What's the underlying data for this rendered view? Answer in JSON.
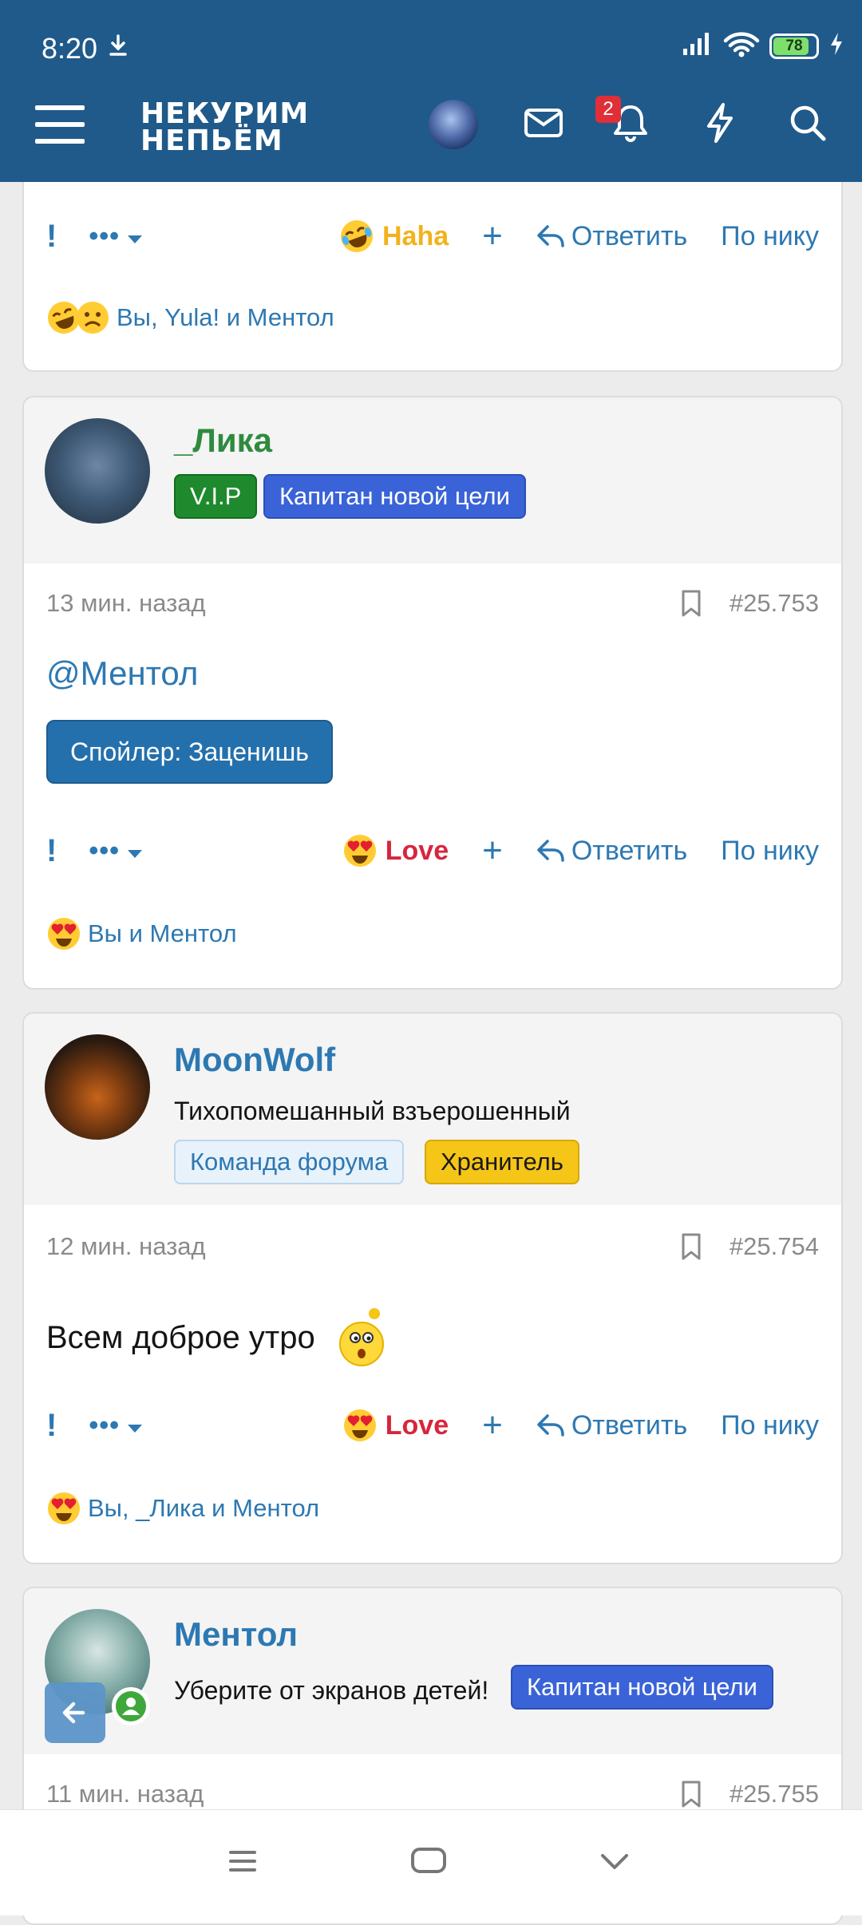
{
  "status": {
    "time": "8:20",
    "battery": "78"
  },
  "header": {
    "logo_line1": "НЕКУРИМ",
    "logo_line2": "НЕПЬЁМ",
    "notif_count": "2"
  },
  "posts": [
    {
      "actions": {
        "reaction": "Haha",
        "reply": "Ответить",
        "by_nick": "По нику"
      },
      "react_summary": "Вы, Yula! и Ментол"
    },
    {
      "user": {
        "name": "_Лика",
        "tags": [
          "V.I.P",
          "Капитан новой цели"
        ]
      },
      "time": "13 мин. назад",
      "number": "#25.753",
      "mention": "@Ментол",
      "spoiler": "Спойлер: Заценишь",
      "actions": {
        "reaction": "Love",
        "reply": "Ответить",
        "by_nick": "По нику"
      },
      "react_summary": "Вы и Ментол"
    },
    {
      "user": {
        "name": "MoonWolf",
        "title": "Тихопомешанный взъерошенный",
        "tags": [
          "Команда форума",
          "Хранитель"
        ]
      },
      "time": "12 мин. назад",
      "number": "#25.754",
      "text": "Всем доброе утро",
      "actions": {
        "reaction": "Love",
        "reply": "Ответить",
        "by_nick": "По нику"
      },
      "react_summary": "Вы, _Лика и Ментол"
    },
    {
      "user": {
        "name": "Ментол",
        "title": "Уберите от экранов детей!",
        "tags": [
          "Капитан новой цели"
        ]
      },
      "time": "11 мин. назад",
      "number": "#25.755"
    }
  ],
  "colors": {
    "header": "#1f5a8a",
    "link": "#2d78b2",
    "love": "#d7263d",
    "haha": "#f2b21b",
    "vip": "#1e8a2d",
    "captain": "#3a63d8"
  }
}
